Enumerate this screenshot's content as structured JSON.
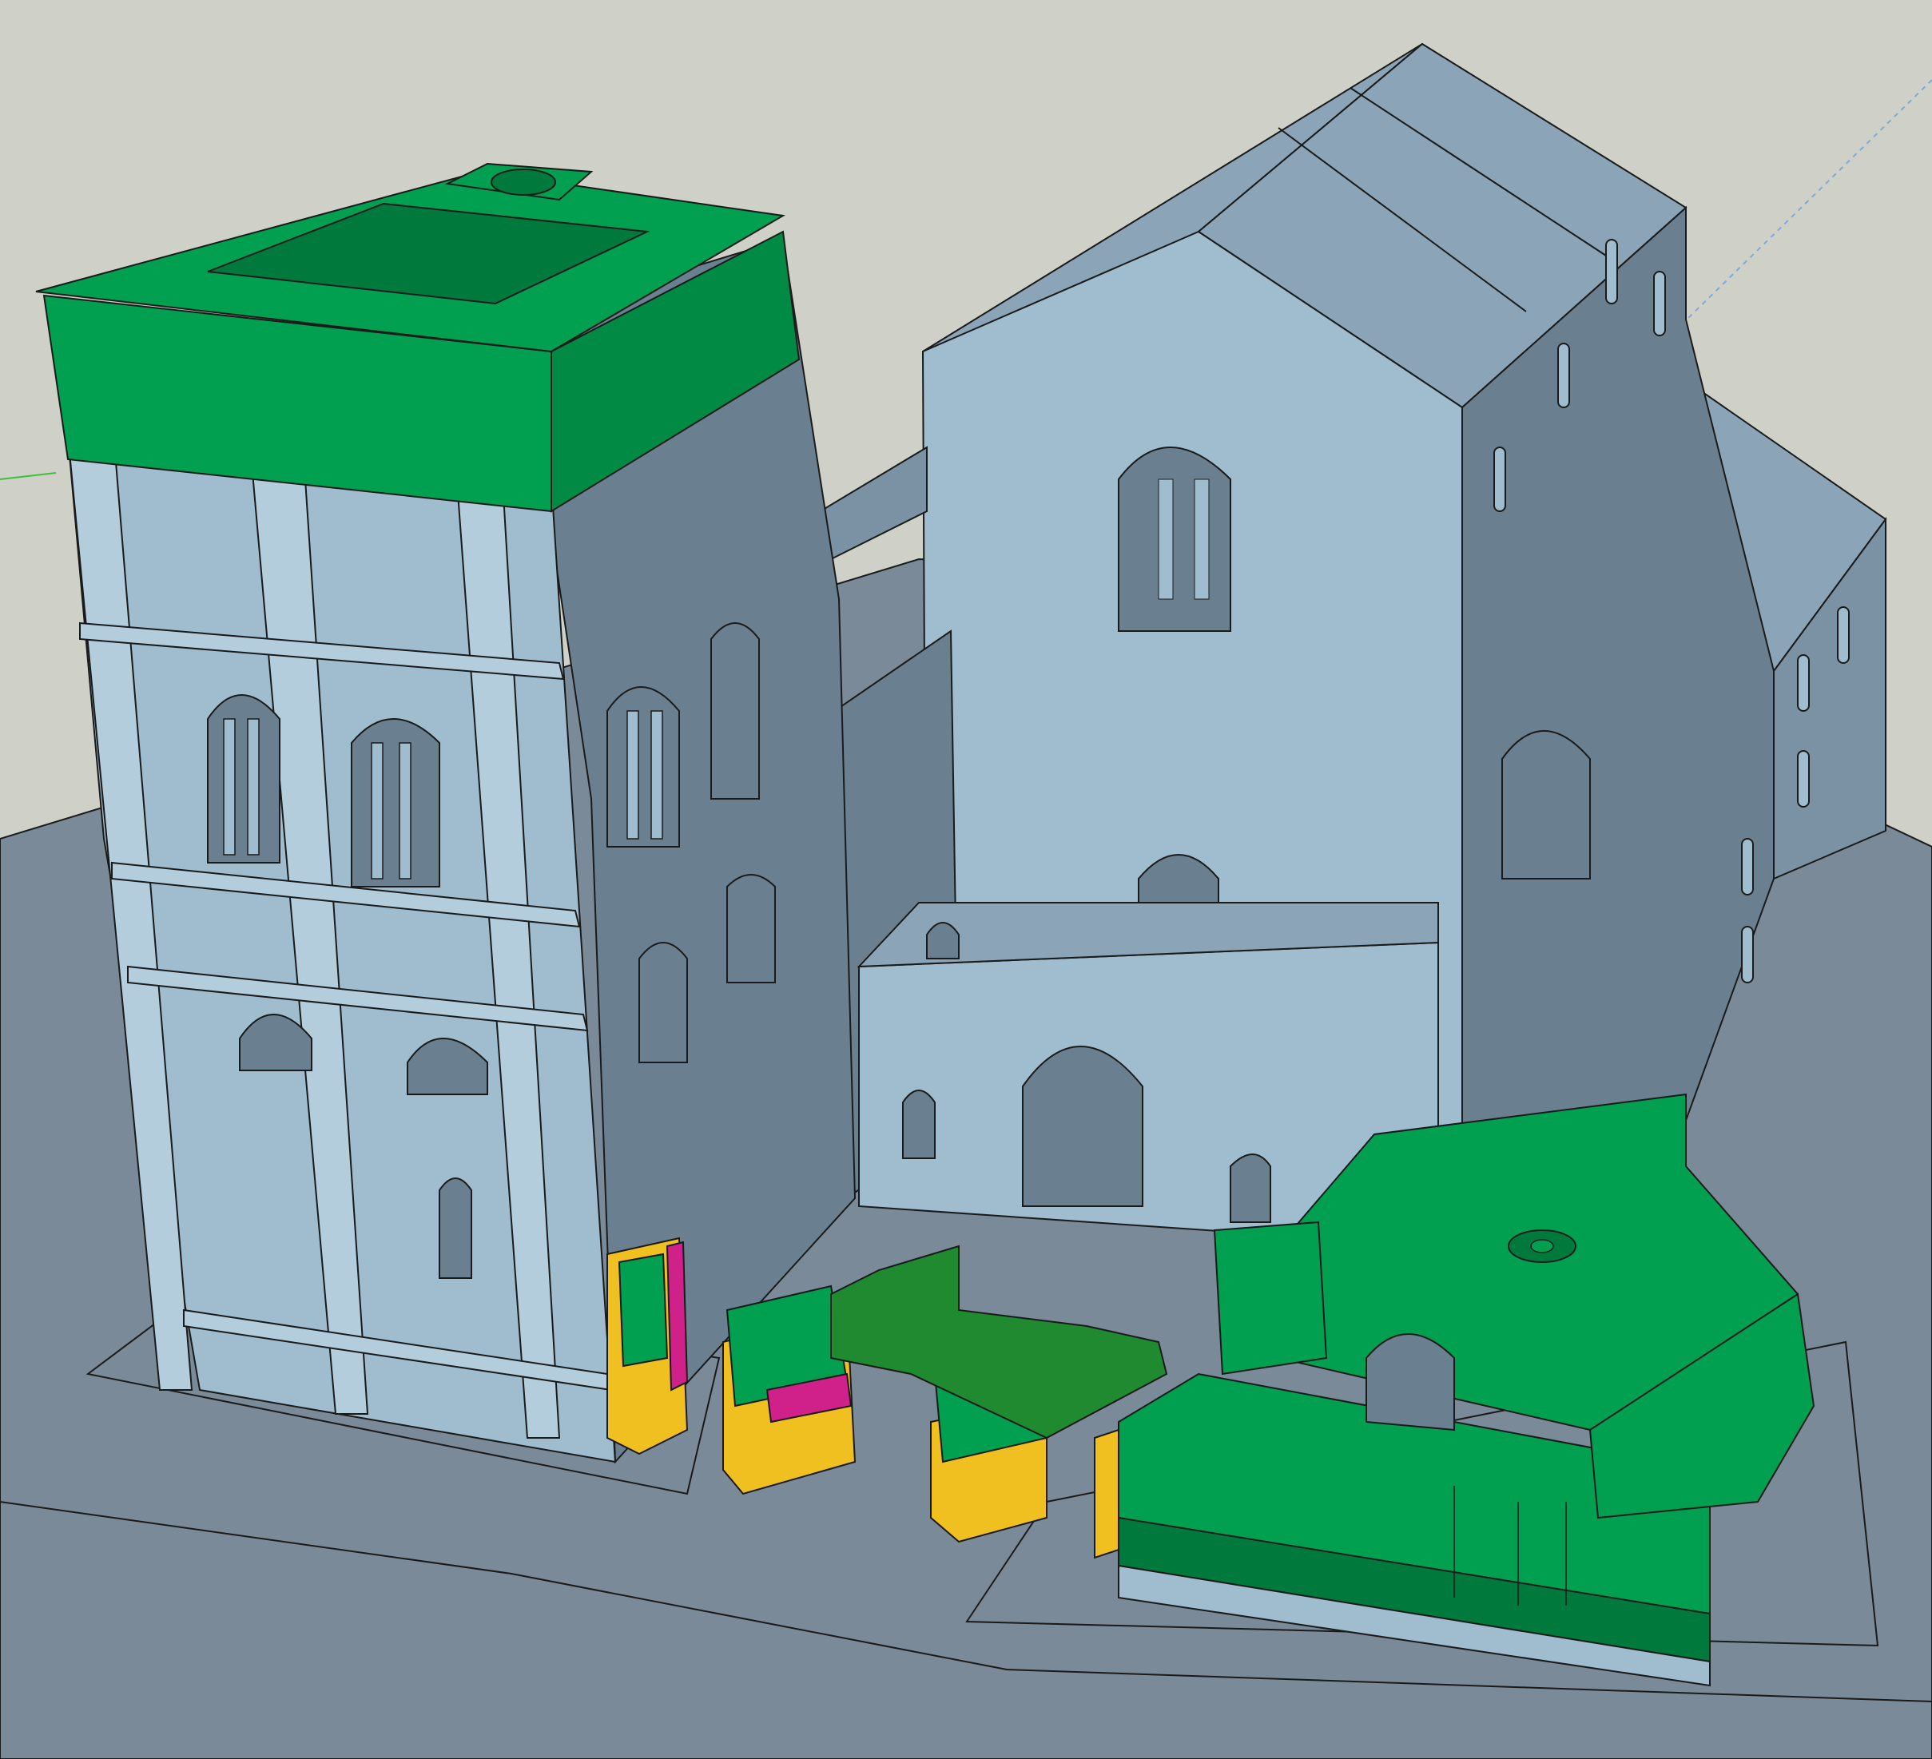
{
  "viewport": {
    "background_color": "#cfd0c8",
    "ground_color": "#7a8a99",
    "face_light": "#a0bccf",
    "face_mid": "#8ba4b7",
    "face_dark": "#6a8090",
    "selected_green": "#00a050",
    "selected_green_dark": "#007a3c",
    "accent_yellow": "#f0c020",
    "accent_magenta": "#d0208a",
    "edge_color": "#1a1a1a",
    "axis_green": "#3cbf3c",
    "axis_blue_dotted": "#7fa8d8"
  },
  "model": {
    "objects": [
      "bell-tower",
      "basilica",
      "transept-walls",
      "cloister-base"
    ]
  }
}
